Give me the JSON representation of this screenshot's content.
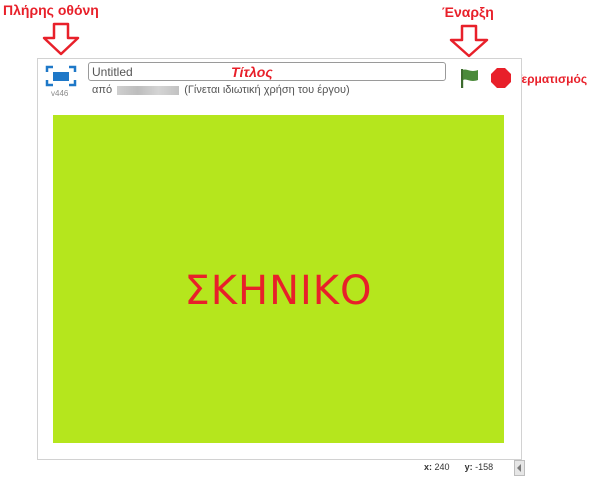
{
  "annotations": {
    "fullscreen": "Πλήρης οθόνη",
    "start": "Έναρξη",
    "title": "Τίτλος",
    "stop": "Τερματισμός"
  },
  "player": {
    "version": "v446",
    "title_value": "Untitled",
    "by_prefix": "από",
    "sharing_note": "(Γίνεται ιδιωτική χρήση του έργου)"
  },
  "stage": {
    "label": "ΣΚΗΝΙΚΟ",
    "background": "#b5e61d"
  },
  "coords": {
    "x_label": "x:",
    "x_value": "240",
    "y_label": "y:",
    "y_value": "-158"
  },
  "colors": {
    "annotation_red": "#e8202a",
    "icon_blue": "#1e78c8",
    "flag_green": "#4a8a3a",
    "stop_red": "#e8202a"
  },
  "icons": [
    "fullscreen-icon",
    "green-flag-icon",
    "stop-sign-icon",
    "down-arrow-icon",
    "scroll-left-icon"
  ]
}
